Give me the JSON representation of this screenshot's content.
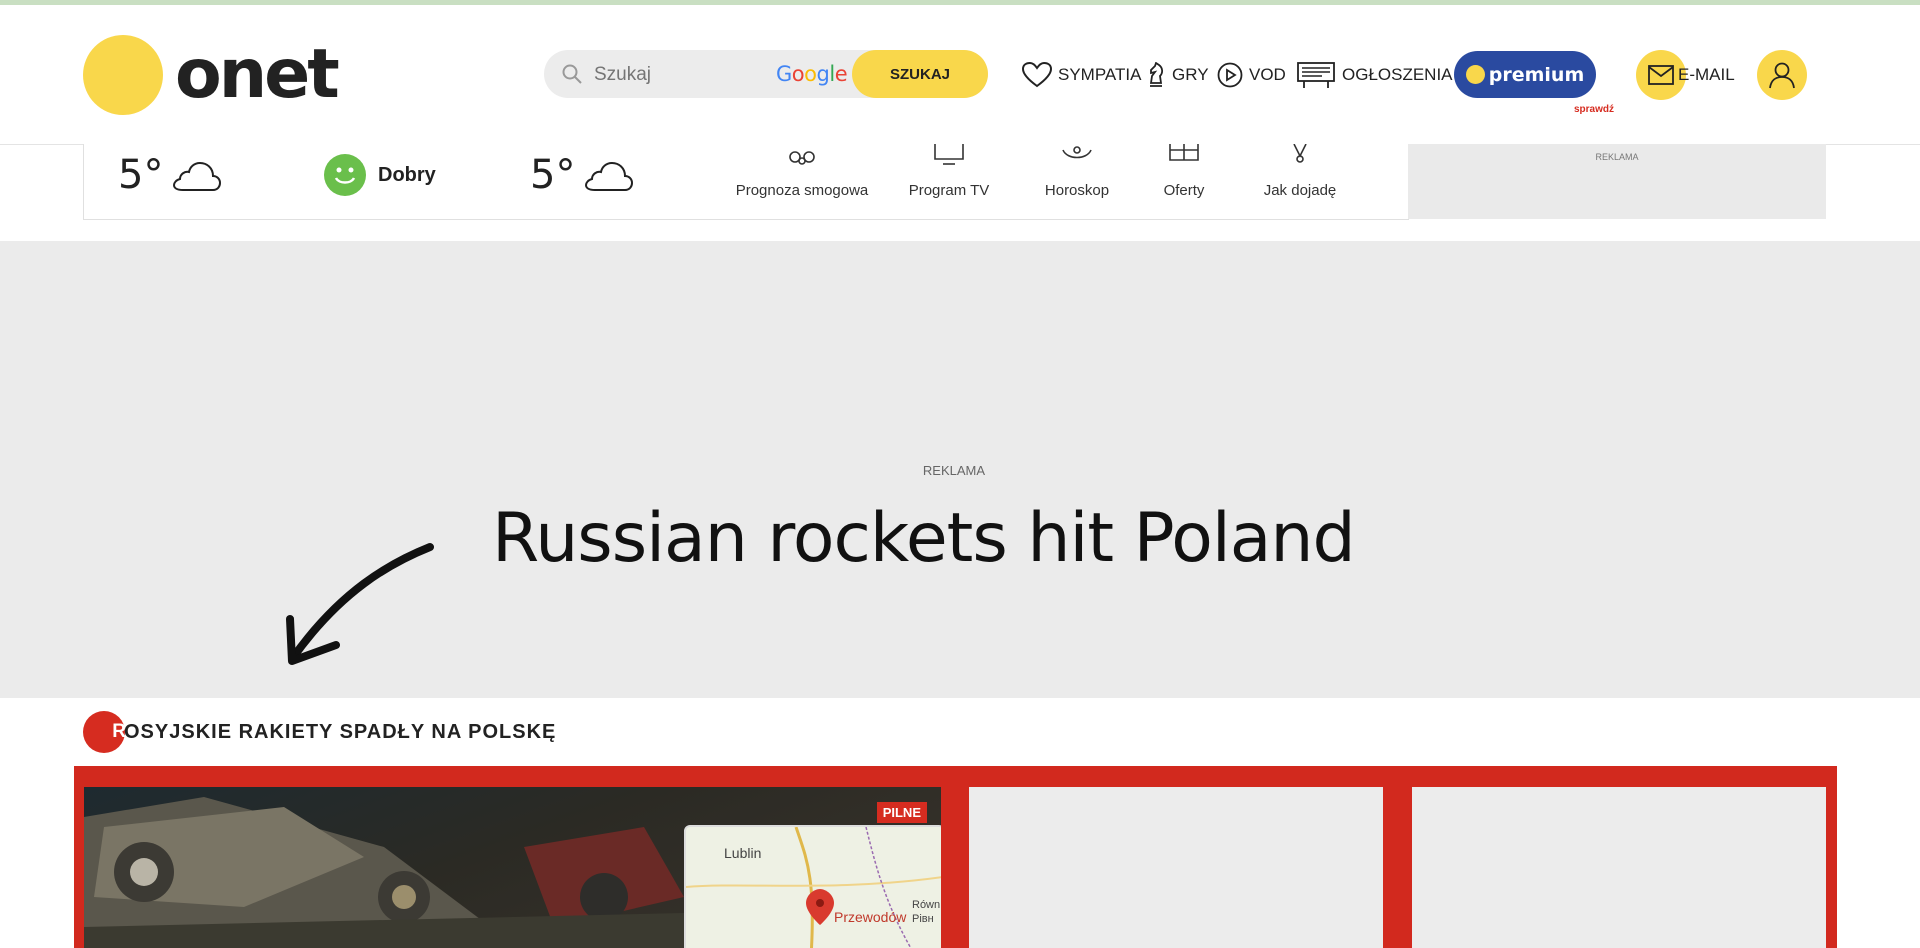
{
  "header": {
    "logo_text": "onet",
    "search": {
      "placeholder": "Szukaj",
      "engine": "Google",
      "button": "SZUKAJ"
    },
    "nav": [
      {
        "label": "SYMPATIA",
        "icon": "heart-icon"
      },
      {
        "label": "GRY",
        "icon": "chess-knight-icon"
      },
      {
        "label": "VOD",
        "icon": "play-circle-icon"
      },
      {
        "label": "OGŁOSZENIA",
        "icon": "billboard-icon"
      }
    ],
    "premium": {
      "label": "premium",
      "note": "sprawdź"
    },
    "email_label": "E-MAIL",
    "colors": {
      "brand_yellow": "#f9d74b",
      "premium_blue": "#2a4aa0",
      "alert_red": "#d62c20"
    }
  },
  "widgets": {
    "weather_today": {
      "temp": "5°",
      "icon": "cloud-icon"
    },
    "air_quality": {
      "label": "Dobry",
      "icon": "smiley-face-icon"
    },
    "weather_tomorrow": {
      "temp": "5°",
      "icon": "cloud-icon"
    },
    "services": [
      {
        "label": "Prognoza smogowa",
        "icon": "gas-mask-icon"
      },
      {
        "label": "Program TV",
        "icon": "tv-icon"
      },
      {
        "label": "Horoskop",
        "icon": "zodiac-icon"
      },
      {
        "label": "Oferty",
        "icon": "gift-icon"
      },
      {
        "label": "Jak dojadę",
        "icon": "route-pin-icon"
      }
    ],
    "ad_label": "REKLAMA"
  },
  "banner": {
    "ad_label": "REKLAMA",
    "headline": "Russian rockets hit Poland"
  },
  "section": {
    "dot_letter": "R",
    "title": "OSYJSKIE RAKIETY SPADŁY NA POLSKĘ",
    "lead": {
      "badge": "PILNE",
      "map_labels": {
        "city1": "Lublin",
        "city2": "Przewodów",
        "city3": "Równ",
        "city4": "Рівн"
      }
    }
  }
}
